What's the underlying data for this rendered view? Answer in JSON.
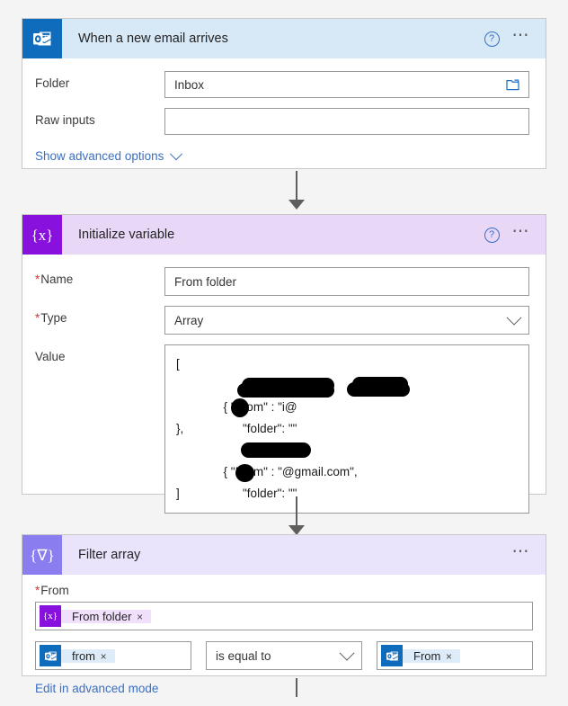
{
  "steps": [
    {
      "id": "trigger",
      "title": "When a new email arrives",
      "icon": "outlook-icon",
      "help_icon": "help-icon",
      "more_icon": "more-options-icon",
      "fields": [
        {
          "label": "Folder",
          "value": "Inbox",
          "required": false,
          "trailing_icon": "folder-picker-icon"
        },
        {
          "label": "Raw inputs",
          "value": "",
          "required": false,
          "trailing_icon": ""
        }
      ],
      "advanced_link": "Show advanced options"
    },
    {
      "id": "initialize-variable",
      "title": "Initialize variable",
      "icon": "variable-braces-icon",
      "icon_glyph": "{x}",
      "help_icon": "help-icon",
      "more_icon": "more-options-icon",
      "fields": [
        {
          "label": "Name",
          "value": "From folder",
          "required": true,
          "trailing_icon": ""
        },
        {
          "label": "Type",
          "value": "Array",
          "required": true,
          "trailing_icon": "chevron-down-icon"
        }
      ],
      "value_label": "Value",
      "value_lines": [
        {
          "text": "[",
          "indent": false
        },
        {
          "text": "{ \"From\" : \"",
          "indent": false,
          "suffix": "i@",
          "redacted": true
        },
        {
          "text": "  \"folder\": \"",
          "indent": true,
          "suffix": "\"",
          "redacted": true
        },
        {
          "text": "},",
          "indent": false
        },
        {
          "text": "{ \"From\" : \"",
          "indent": false,
          "suffix": "@gmail.com\",",
          "redacted": true
        },
        {
          "text": "  \"folder\": \"",
          "indent": true,
          "suffix": "\"",
          "redacted": true
        },
        {
          "text": "]",
          "indent": false
        }
      ]
    },
    {
      "id": "filter-array",
      "title": "Filter array",
      "icon": "filter-funnel-icon",
      "icon_glyph": "{∇}",
      "more_icon": "more-options-icon",
      "from_label": "From",
      "from_required": true,
      "from_token": {
        "label": "From folder",
        "icon": "variable-braces-icon",
        "remove": "×"
      },
      "condition": {
        "left_token": {
          "label": "from",
          "icon": "outlook-icon",
          "remove": "×"
        },
        "operator": "is equal to",
        "operator_icon": "chevron-down-icon",
        "right_token": {
          "label": "From",
          "icon": "outlook-icon",
          "remove": "×"
        }
      },
      "advanced_link": "Edit in advanced mode"
    }
  ],
  "colors": {
    "page_background": "#f4f4f4",
    "trigger_header": "#d7e8f7",
    "variable_header": "#e8d7f7",
    "filter_header": "#e9e4fb",
    "outlook_tile": "#0f6cbd",
    "variable_tile": "#8811dd",
    "filter_tile": "#8a7df0",
    "link": "#3b6fc4",
    "required_star": "#d13438",
    "connector": "#605e5c"
  }
}
